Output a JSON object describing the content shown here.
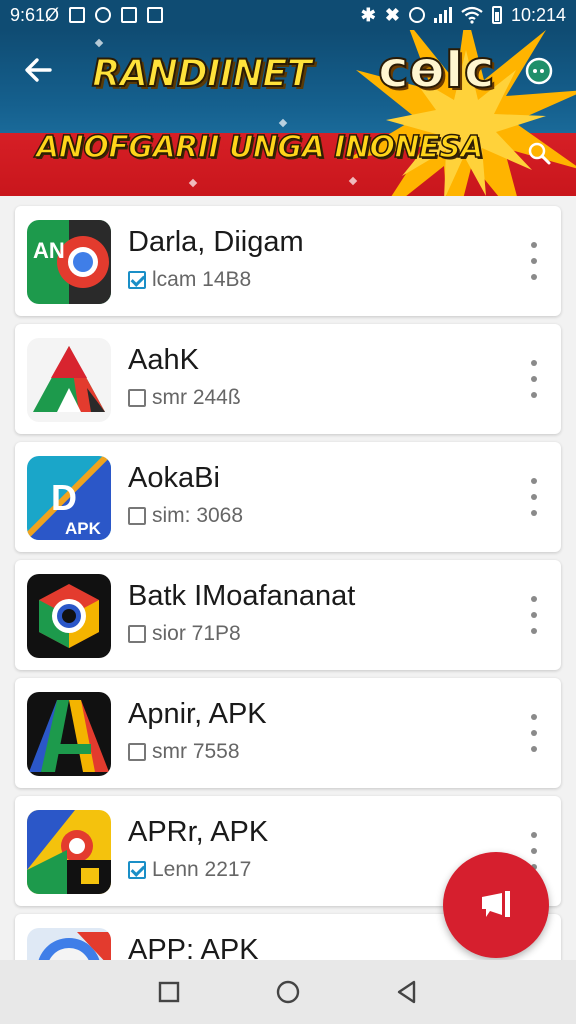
{
  "status_bar": {
    "left_text": "9:61Ø",
    "time": "10:214",
    "icons": [
      "image-icon",
      "notification-icon",
      "briefcase-icon",
      "bluetooth-icon",
      "mute-icon",
      "alarm-icon",
      "signal-icon",
      "wifi-icon",
      "battery-icon"
    ]
  },
  "banner": {
    "title": "RANDIINET",
    "badge": "сөІс",
    "subtitle": "ANOFGARII UNGA INONESA",
    "colors": {
      "blue": "#0f4c73",
      "red": "#d61f26",
      "yellow": "#ffe23a",
      "burst": "#ffb400"
    }
  },
  "apps": [
    {
      "name": "Darla, Diigam",
      "meta": "lcam 14B8",
      "checked": true,
      "icon": "app-icon-an-green"
    },
    {
      "name": "AahK",
      "meta": "smr 244ß",
      "checked": false,
      "icon": "app-icon-triangle"
    },
    {
      "name": "AokaBi",
      "meta": "sim: 3068",
      "checked": false,
      "icon": "app-icon-apk-stripe"
    },
    {
      "name": "Batk IMoafananat",
      "meta": "sior 71P8",
      "checked": false,
      "icon": "app-icon-chrome-dark"
    },
    {
      "name": "Apnir, APK",
      "meta": "smr 7558",
      "checked": false,
      "icon": "app-icon-a-rainbow"
    },
    {
      "name": "APRr, APK",
      "meta": "Lenn 2217",
      "checked": true,
      "icon": "app-icon-colorful"
    },
    {
      "name": "APP: APK",
      "meta": "",
      "checked": false,
      "icon": "app-icon-partial"
    }
  ],
  "fab": {
    "icon": "feedback-flag-icon",
    "color": "#d61f2e"
  },
  "nav": {
    "recents": "square-icon",
    "home": "circle-icon",
    "back": "triangle-back-icon"
  }
}
